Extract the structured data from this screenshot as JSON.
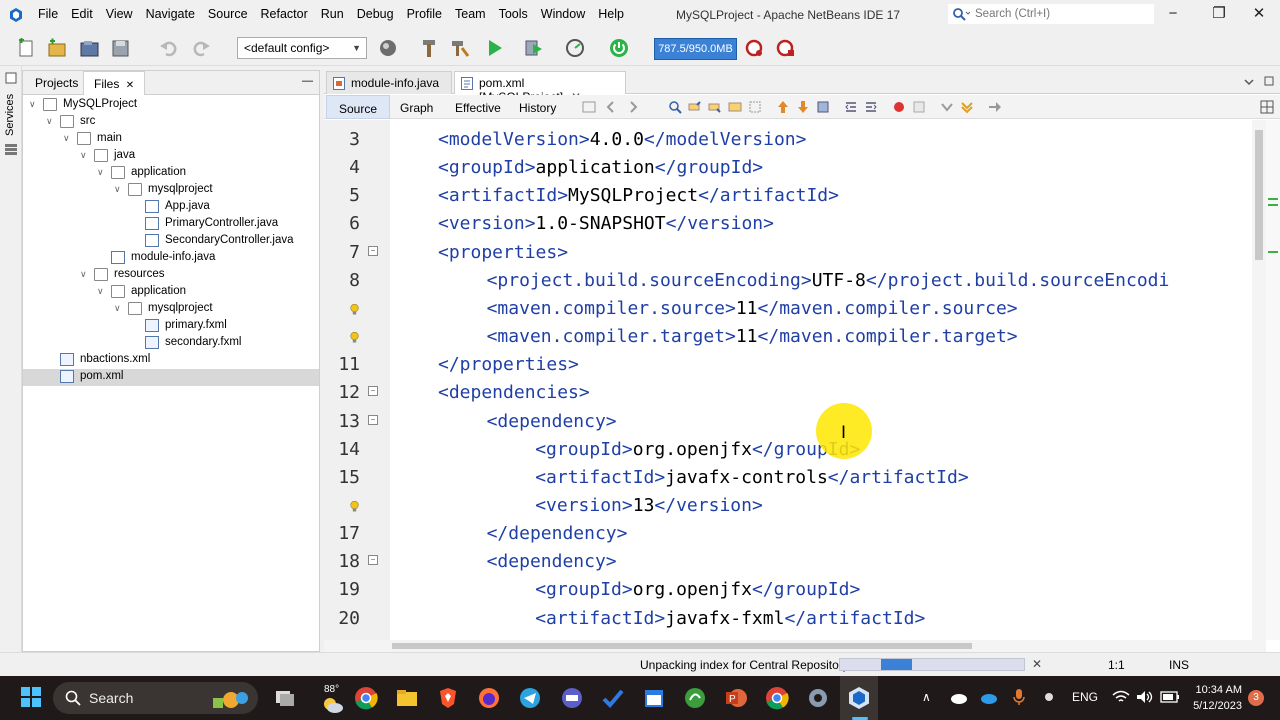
{
  "window": {
    "title": "MySQLProject - Apache NetBeans IDE 17",
    "search_placeholder": "Search (Ctrl+I)",
    "controls": [
      "−",
      "❐",
      "✕"
    ]
  },
  "menu": [
    "File",
    "Edit",
    "View",
    "Navigate",
    "Source",
    "Refactor",
    "Run",
    "Debug",
    "Profile",
    "Team",
    "Tools",
    "Window",
    "Help"
  ],
  "toolbar": {
    "config": "<default config>",
    "memory": "787.5/950.0MB"
  },
  "services_label": "Services",
  "left_panel": {
    "tabs": [
      {
        "label": "Projects",
        "active": false
      },
      {
        "label": "Files",
        "active": true,
        "close": "✕"
      }
    ],
    "minimize": "—",
    "tree": [
      {
        "label": "MySQLProject",
        "depth": 0,
        "twisty": "∨",
        "icon": "project-folder-icon"
      },
      {
        "label": "src",
        "depth": 1,
        "twisty": "∨",
        "icon": "folder-icon"
      },
      {
        "label": "main",
        "depth": 2,
        "twisty": "∨",
        "icon": "folder-icon"
      },
      {
        "label": "java",
        "depth": 3,
        "twisty": "∨",
        "icon": "folder-icon"
      },
      {
        "label": "application",
        "depth": 4,
        "twisty": "∨",
        "icon": "folder-icon"
      },
      {
        "label": "mysqlproject",
        "depth": 5,
        "twisty": "∨",
        "icon": "folder-icon"
      },
      {
        "label": "App.java",
        "depth": 6,
        "twisty": "",
        "icon": "java-file-icon"
      },
      {
        "label": "PrimaryController.java",
        "depth": 6,
        "twisty": "",
        "icon": "java-file-icon"
      },
      {
        "label": "SecondaryController.java",
        "depth": 6,
        "twisty": "",
        "icon": "java-file-icon"
      },
      {
        "label": "module-info.java",
        "depth": 4,
        "twisty": "",
        "icon": "java-file-icon"
      },
      {
        "label": "resources",
        "depth": 3,
        "twisty": "∨",
        "icon": "folder-icon"
      },
      {
        "label": "application",
        "depth": 4,
        "twisty": "∨",
        "icon": "folder-icon"
      },
      {
        "label": "mysqlproject",
        "depth": 5,
        "twisty": "∨",
        "icon": "folder-icon"
      },
      {
        "label": "primary.fxml",
        "depth": 6,
        "twisty": "",
        "icon": "fxml-file-icon"
      },
      {
        "label": "secondary.fxml",
        "depth": 6,
        "twisty": "",
        "icon": "fxml-file-icon"
      },
      {
        "label": "nbactions.xml",
        "depth": 1,
        "twisty": "",
        "icon": "xml-file-icon"
      },
      {
        "label": "pom.xml",
        "depth": 1,
        "twisty": "",
        "icon": "xml-file-icon",
        "selected": true
      }
    ]
  },
  "editor": {
    "tabs": [
      {
        "label": "module-info.java",
        "close": "✕",
        "active": false
      },
      {
        "label": "pom.xml [MySQLProject]",
        "close": "✕",
        "active": true
      }
    ],
    "view_tabs": [
      "Source",
      "Graph",
      "Effective",
      "History"
    ],
    "lines": [
      {
        "num": "3",
        "indent": 1,
        "parts": [
          [
            "tag",
            "<modelVersion>"
          ],
          [
            "txt",
            "4.0.0"
          ],
          [
            "tag",
            "</modelVersion>"
          ]
        ]
      },
      {
        "num": "4",
        "indent": 1,
        "parts": [
          [
            "tag",
            "<groupId>"
          ],
          [
            "txt",
            "application"
          ],
          [
            "tag",
            "</groupId>"
          ]
        ]
      },
      {
        "num": "5",
        "indent": 1,
        "parts": [
          [
            "tag",
            "<artifactId>"
          ],
          [
            "txt",
            "MySQLProject"
          ],
          [
            "tag",
            "</artifactId>"
          ]
        ]
      },
      {
        "num": "6",
        "indent": 1,
        "parts": [
          [
            "tag",
            "<version>"
          ],
          [
            "txt",
            "1.0-SNAPSHOT"
          ],
          [
            "tag",
            "</version>"
          ]
        ]
      },
      {
        "num": "7",
        "indent": 1,
        "fold": true,
        "parts": [
          [
            "tag",
            "<properties>"
          ]
        ]
      },
      {
        "num": "8",
        "indent": 2,
        "parts": [
          [
            "tag",
            "<project.build.sourceEncoding>"
          ],
          [
            "txt",
            "UTF-8"
          ],
          [
            "tag",
            "</project.build.sourceEncodi"
          ]
        ]
      },
      {
        "num": "",
        "indent": 2,
        "bulb": true,
        "parts": [
          [
            "tag",
            "<maven.compiler.source>"
          ],
          [
            "txt",
            "11"
          ],
          [
            "tag",
            "</maven.compiler.source>"
          ]
        ]
      },
      {
        "num": "",
        "indent": 2,
        "bulb": true,
        "parts": [
          [
            "tag",
            "<maven.compiler.target>"
          ],
          [
            "txt",
            "11"
          ],
          [
            "tag",
            "</maven.compiler.target>"
          ]
        ]
      },
      {
        "num": "11",
        "indent": 1,
        "parts": [
          [
            "tag",
            "</properties>"
          ]
        ]
      },
      {
        "num": "12",
        "indent": 1,
        "fold": true,
        "parts": [
          [
            "tag",
            "<dependencies>"
          ]
        ]
      },
      {
        "num": "13",
        "indent": 2,
        "fold": true,
        "parts": [
          [
            "tag",
            "<dependency>"
          ]
        ]
      },
      {
        "num": "14",
        "indent": 3,
        "parts": [
          [
            "tag",
            "<groupId>"
          ],
          [
            "txt",
            "org.openjfx"
          ],
          [
            "tag",
            "</groupId>"
          ]
        ]
      },
      {
        "num": "15",
        "indent": 3,
        "parts": [
          [
            "tag",
            "<artifactId>"
          ],
          [
            "txt",
            "javafx-controls"
          ],
          [
            "tag",
            "</artifactId>"
          ]
        ]
      },
      {
        "num": "",
        "indent": 3,
        "bulb": true,
        "parts": [
          [
            "tag",
            "<version>"
          ],
          [
            "txt",
            "13"
          ],
          [
            "tag",
            "</version>"
          ]
        ]
      },
      {
        "num": "17",
        "indent": 2,
        "parts": [
          [
            "tag",
            "</dependency>"
          ]
        ]
      },
      {
        "num": "18",
        "indent": 2,
        "fold": true,
        "parts": [
          [
            "tag",
            "<dependency>"
          ]
        ]
      },
      {
        "num": "19",
        "indent": 3,
        "parts": [
          [
            "tag",
            "<groupId>"
          ],
          [
            "txt",
            "org.openjfx"
          ],
          [
            "tag",
            "</groupId>"
          ]
        ]
      },
      {
        "num": "20",
        "indent": 3,
        "parts": [
          [
            "tag",
            "<artifactId>"
          ],
          [
            "txt",
            "javafx-fxml"
          ],
          [
            "tag",
            "</artifactId>"
          ]
        ]
      }
    ]
  },
  "status": {
    "message": "Unpacking index for Central Repository",
    "progress": 0.17,
    "cancel": "✕",
    "position": "1:1",
    "mode": "INS"
  },
  "taskbar": {
    "search_placeholder": "Search",
    "weather_temp": "88°",
    "language": "ENG",
    "time": "10:34 AM",
    "date": "5/12/2023",
    "notifications": "3",
    "tray_chevron": "∧"
  },
  "colors": {
    "xml_tag": "#1f3fa6",
    "accent": "#3b82d6"
  }
}
